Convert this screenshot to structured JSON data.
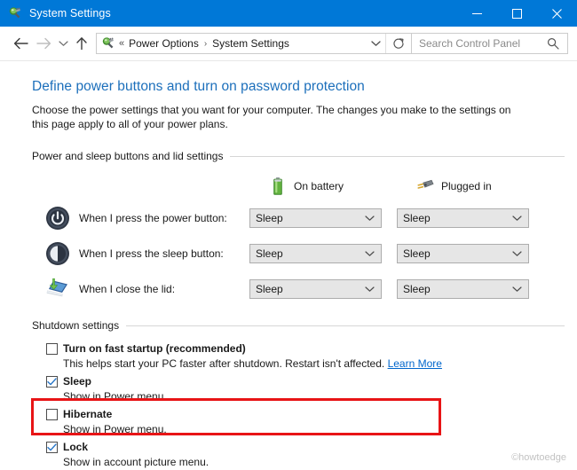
{
  "window": {
    "title": "System Settings",
    "icon": "power-options-icon",
    "controls": {
      "minimize": "minimize-icon",
      "maximize": "maximize-icon",
      "close": "close-icon"
    },
    "titlebar_color": "#0078d7"
  },
  "navbar": {
    "back": "back-arrow-icon",
    "forward": "forward-arrow-icon",
    "recent": "recent-pages-icon",
    "up": "up-arrow-icon",
    "address": {
      "icon": "power-options-icon",
      "overflow": "«",
      "crumbs": [
        "Power Options",
        "System Settings"
      ],
      "separator": "›",
      "dropdown": "chevron-down-icon"
    },
    "refresh": "refresh-icon",
    "search": {
      "placeholder": "Search Control Panel",
      "value": "",
      "icon": "search-icon"
    }
  },
  "main": {
    "heading": "Define power buttons and turn on password protection",
    "description": "Choose the power settings that you want for your computer. The changes you make to the settings on this page apply to all of your power plans.",
    "heading_color": "#1c6fbb"
  },
  "power_section": {
    "title": "Power and sleep buttons and lid settings",
    "columns": [
      {
        "label": "On battery",
        "icon": "battery-icon"
      },
      {
        "label": "Plugged in",
        "icon": "power-plug-icon"
      }
    ],
    "rows": [
      {
        "icon": "power-button-icon",
        "label": "When I press the power button:",
        "on_battery": "Sleep",
        "plugged_in": "Sleep"
      },
      {
        "icon": "sleep-button-icon",
        "label": "When I press the sleep button:",
        "on_battery": "Sleep",
        "plugged_in": "Sleep"
      },
      {
        "icon": "close-lid-icon",
        "label": "When I close the lid:",
        "on_battery": "Sleep",
        "plugged_in": "Sleep"
      }
    ]
  },
  "shutdown_section": {
    "title": "Shutdown settings",
    "items": [
      {
        "label": "Turn on fast startup (recommended)",
        "checked": false,
        "description": "This helps start your PC faster after shutdown. Restart isn't affected.",
        "link": "Learn More",
        "highlighted": true
      },
      {
        "label": "Sleep",
        "checked": true,
        "description": "Show in Power menu.",
        "link": "",
        "highlighted": false
      },
      {
        "label": "Hibernate",
        "checked": false,
        "description": "Show in Power menu.",
        "link": "",
        "highlighted": false
      },
      {
        "label": "Lock",
        "checked": true,
        "description": "Show in account picture menu.",
        "link": "",
        "highlighted": false
      }
    ],
    "highlight_color": "#e81416"
  },
  "watermark": "©howtoedge"
}
